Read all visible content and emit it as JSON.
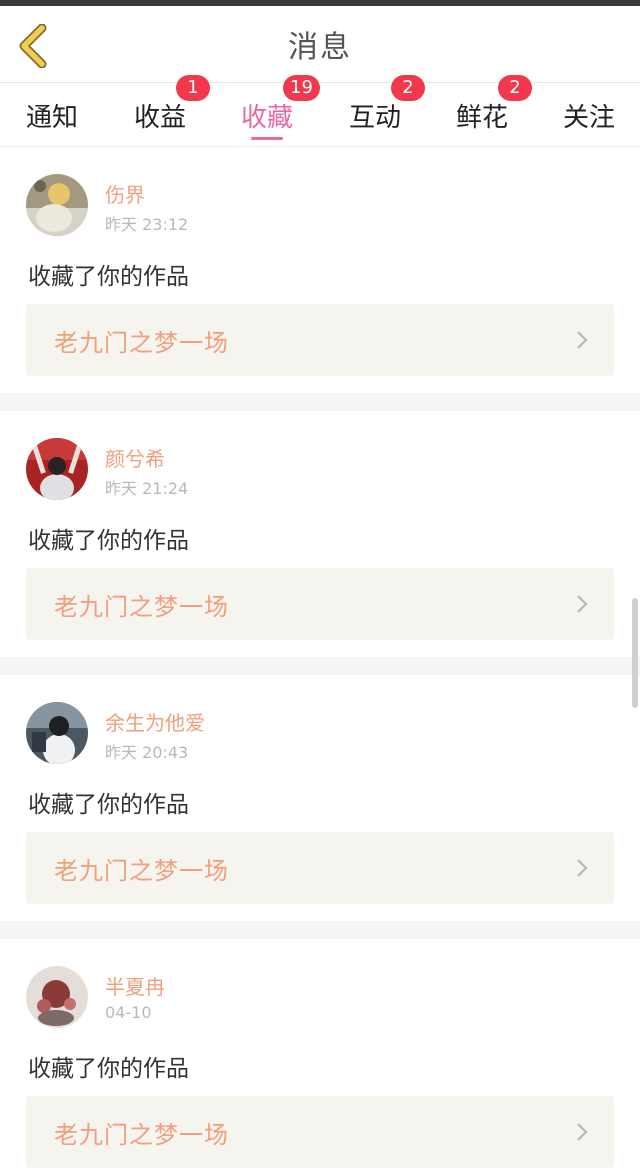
{
  "header": {
    "title": "消息",
    "back_icon": "chevron-left-icon"
  },
  "tabs": [
    {
      "label": "通知",
      "badge": null,
      "active": false
    },
    {
      "label": "收益",
      "badge": "1",
      "active": false
    },
    {
      "label": "收藏",
      "badge": "19",
      "active": true
    },
    {
      "label": "互动",
      "badge": "2",
      "active": false
    },
    {
      "label": "鲜花",
      "badge": "2",
      "active": false
    },
    {
      "label": "关注",
      "badge": null,
      "active": false
    }
  ],
  "messages": [
    {
      "user": "伤界",
      "time": "昨天 23:12",
      "action": "收藏了你的作品",
      "work": "老九门之梦一场"
    },
    {
      "user": "颜兮希",
      "time": "昨天 21:24",
      "action": "收藏了你的作品",
      "work": "老九门之梦一场"
    },
    {
      "user": "余生为他爱",
      "time": "昨天 20:43",
      "action": "收藏了你的作品",
      "work": "老九门之梦一场"
    },
    {
      "user": "半夏冉",
      "time": "04-10",
      "action": "收藏了你的作品",
      "work": "老九门之梦一场"
    }
  ],
  "colors": {
    "accent_pink": "#e86aa4",
    "badge_red": "#f2384d",
    "username_orange": "#f0a07c",
    "back_arrow_yellow": "#f1cb52"
  }
}
